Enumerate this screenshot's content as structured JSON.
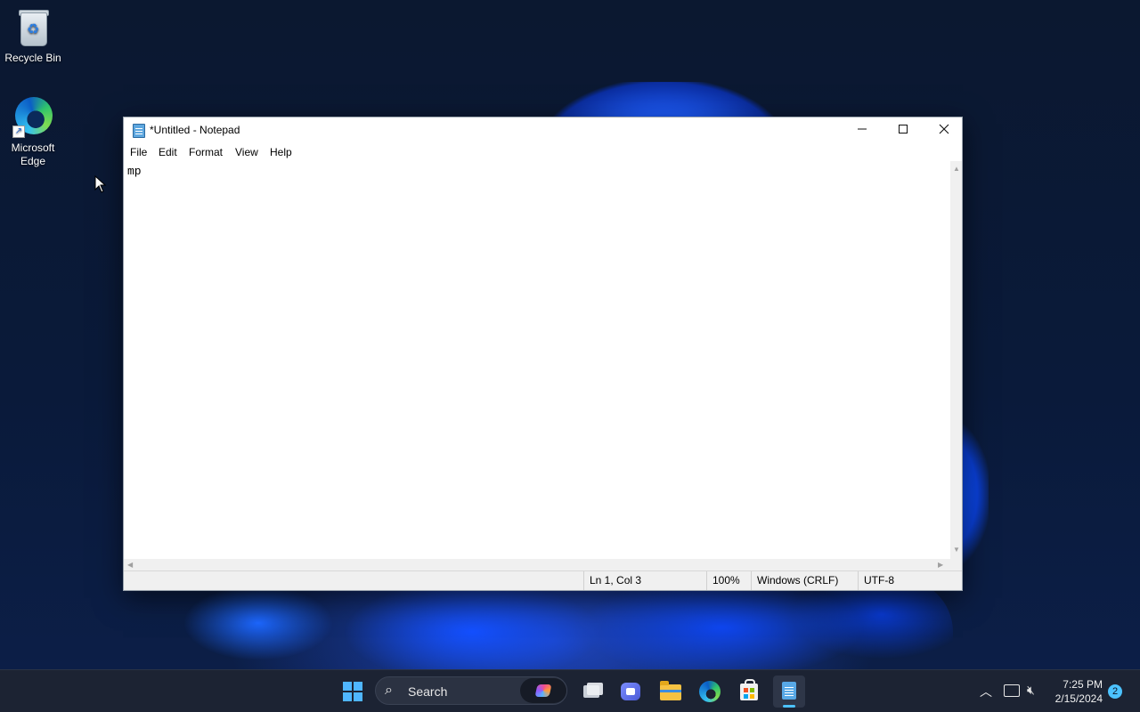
{
  "desktop": {
    "icons": [
      {
        "label": "Recycle Bin"
      },
      {
        "label": "Microsoft Edge"
      }
    ]
  },
  "notepad": {
    "title": "*Untitled - Notepad",
    "menu": [
      "File",
      "Edit",
      "Format",
      "View",
      "Help"
    ],
    "content": "mp",
    "status": {
      "position": "Ln 1, Col 3",
      "zoom": "100%",
      "line_ending": "Windows (CRLF)",
      "encoding": "UTF-8"
    }
  },
  "taskbar": {
    "search_label": "Search",
    "time": "7:25 PM",
    "date": "2/15/2024",
    "notification_count": "2",
    "icons": [
      "start-icon",
      "search-icon",
      "copilot-icon",
      "task-view-icon",
      "meet-icon",
      "file-explorer-icon",
      "edge-icon",
      "store-icon",
      "notepad-icon"
    ]
  },
  "colors": {
    "accent": "#4cc2ff",
    "taskbar": "#1c2333"
  }
}
